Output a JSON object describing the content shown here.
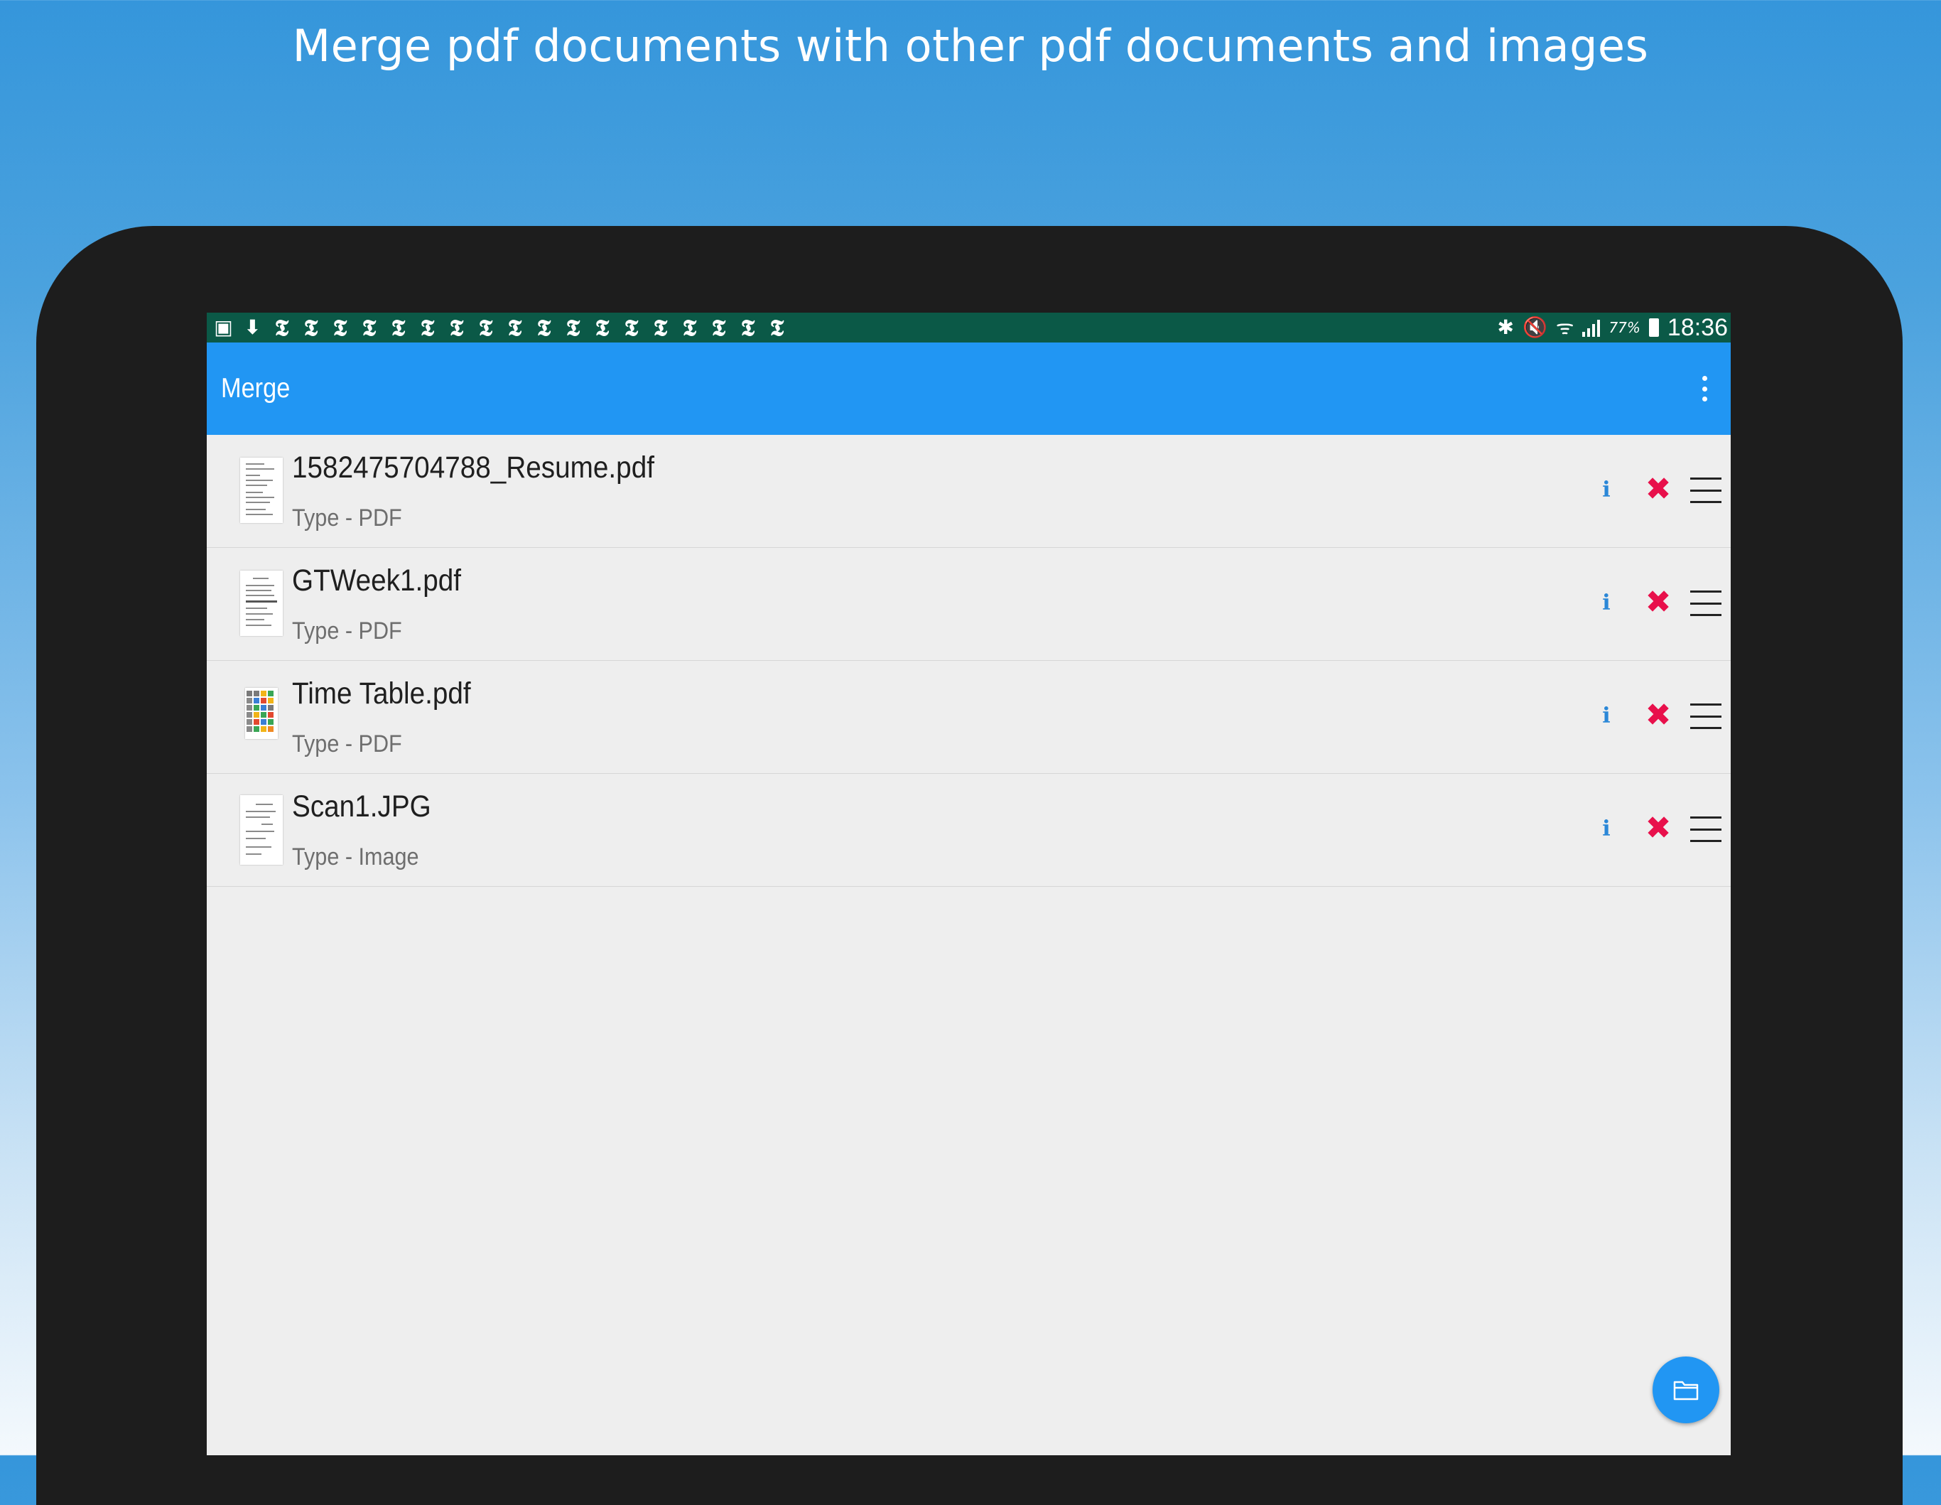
{
  "banner": {
    "headline": "Merge pdf documents with other pdf documents and images"
  },
  "status_bar": {
    "notification_icons": [
      "gallery-icon",
      "download-icon",
      "nyt-icon",
      "nyt-icon",
      "nyt-icon",
      "nyt-icon",
      "nyt-icon",
      "nyt-icon",
      "nyt-icon",
      "nyt-icon",
      "nyt-icon",
      "nyt-icon",
      "nyt-icon",
      "nyt-icon",
      "nyt-icon",
      "nyt-icon",
      "nyt-icon",
      "nyt-icon",
      "nyt-icon",
      "nyt-icon"
    ],
    "nyt_glyph": "𝕿",
    "battery": "77%",
    "time": "18:36"
  },
  "app_bar": {
    "title": "Merge"
  },
  "files": [
    {
      "name": "1582475704788_Resume.pdf",
      "type": "Type - PDF",
      "thumb": "document-thumbnail"
    },
    {
      "name": "GTWeek1.pdf",
      "type": "Type - PDF",
      "thumb": "document-thumbnail"
    },
    {
      "name": "Time Table.pdf",
      "type": "Type - PDF",
      "thumb": "timetable-thumbnail"
    },
    {
      "name": "Scan1.JPG",
      "type": "Type - Image",
      "thumb": "scan-thumbnail"
    }
  ],
  "row_actions": {
    "info_glyph": "i",
    "remove_glyph": "✖"
  },
  "colors": {
    "status_bar": "#0b5947",
    "app_bar": "#2196f3",
    "info": "#2b87d7",
    "remove": "#e8104b",
    "fab": "#2196f3"
  }
}
